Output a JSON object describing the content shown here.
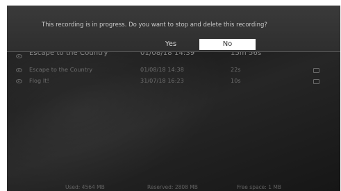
{
  "dialog": {
    "message": "This recording is in progress. Do you want to stop and delete this recording?",
    "yes_label": "Yes",
    "no_label": "No"
  },
  "recordings": [
    {
      "title": "Escape to the Country",
      "date": "01/08/18 14:39",
      "duration": "15m 56s"
    },
    {
      "title": "Escape to the Country",
      "date": "01/08/18 14:38",
      "duration": "22s"
    },
    {
      "title": "Flog It!",
      "date": "31/07/18 16:23",
      "duration": "10s"
    }
  ],
  "footer": {
    "used": "Used: 4564 MB",
    "reserved": "Reserved: 2808 MB",
    "free": "Free space: 1 MB"
  },
  "icons": {
    "row_left": "eye-icon",
    "row_right": "message-icon"
  },
  "colors": {
    "background": "#222222",
    "selected_button": "#ffffff"
  }
}
